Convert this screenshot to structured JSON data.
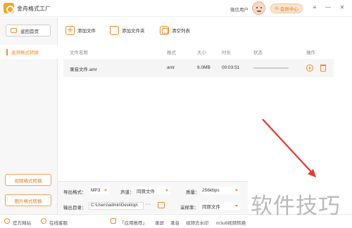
{
  "app": {
    "title": "金舟格式工厂"
  },
  "header": {
    "user_label": "微信用户",
    "vip_label": "会员中心",
    "controls": {
      "menu": "≡",
      "minimize": "—",
      "close": "✕"
    }
  },
  "sidebar": {
    "back_label": "返回首页",
    "active_item": "高频格式转换",
    "bottom_buttons": [
      "视频格式转换",
      "图片格式转换"
    ]
  },
  "toolbar": {
    "add_file": "添加文件",
    "add_folder": "添加文件夹",
    "clear_list": "清空列表"
  },
  "table": {
    "columns": [
      "文件名称",
      "格式",
      "大小",
      "时长",
      "状态",
      "操作"
    ],
    "rows": [
      {
        "name": "录音文件.amr",
        "format": "amr",
        "size": "9.0MB",
        "duration": "00:03:51",
        "progress": 0
      }
    ]
  },
  "settings": {
    "export_format_label": "导出格式：",
    "export_format_value": "MP3",
    "channel_label": "声道：",
    "channel_value": "同原文件",
    "quality_label": "质量：",
    "quality_value": "256kbps",
    "output_dir_label": "输出目录：",
    "output_dir_value": "C:\\Users\\admin\\Desktop\\",
    "browse_label": "···",
    "sample_rate_label": "采样率：",
    "sample_rate_value": "同原文件"
  },
  "footer": {
    "website": "官方网站",
    "support": "在线客服",
    "recommend": "「应用推荐」",
    "links": [
      "录屏",
      "录音",
      "视频去水印",
      "m3u8视频转换"
    ]
  },
  "watermark": "软件技巧",
  "colors": {
    "accent": "#f08a24",
    "arrow": "#e8372c"
  }
}
